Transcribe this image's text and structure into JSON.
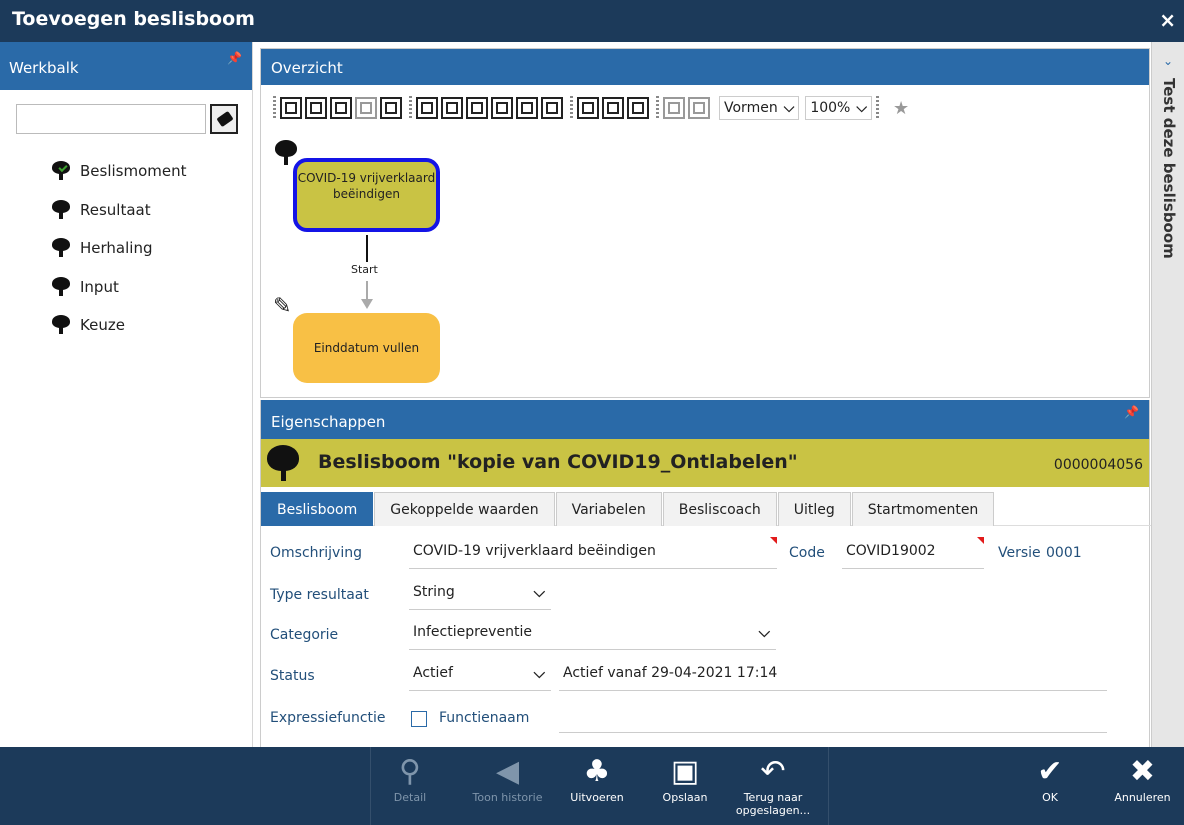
{
  "window": {
    "title": "Toevoegen beslisboom",
    "close_label": "×"
  },
  "werkbalk": {
    "title": "Werkbalk",
    "search_value": "",
    "items": [
      {
        "label": "Beslismoment"
      },
      {
        "label": "Resultaat"
      },
      {
        "label": "Herhaling"
      },
      {
        "label": "Input"
      },
      {
        "label": "Keuze"
      }
    ]
  },
  "overzicht": {
    "title": "Overzicht",
    "shape_select": "Vormen",
    "zoom_select": "100%",
    "nodes": {
      "node1_label": "COVID-19 vrijverklaard beëindigen",
      "connector_label": "Start",
      "node2_label": "Einddatum vullen"
    }
  },
  "eigenschappen": {
    "title": "Eigenschappen",
    "banner_title": "Beslisboom \"kopie van COVID19_Ontlabelen\"",
    "banner_number": "0000004056",
    "tabs": [
      {
        "label": "Beslisboom",
        "active": true
      },
      {
        "label": "Gekoppelde waarden"
      },
      {
        "label": "Variabelen"
      },
      {
        "label": "Besliscoach"
      },
      {
        "label": "Uitleg"
      },
      {
        "label": "Startmomenten"
      }
    ],
    "form": {
      "omschrijving_label": "Omschrijving",
      "omschrijving_value": "COVID-19 vrijverklaard beëindigen",
      "code_label": "Code",
      "code_value": "COVID19002",
      "versie_label": "Versie",
      "versie_value": "0001",
      "type_label": "Type resultaat",
      "type_value": "String",
      "categorie_label": "Categorie",
      "categorie_value": "Infectiepreventie",
      "status_label": "Status",
      "status_value": "Actief",
      "status_info": "Actief vanaf 29-04-2021 17:14",
      "expressie_label": "Expressiefunctie",
      "functienaam_label": "Functienaam"
    }
  },
  "rightbar": {
    "label": "Test deze beslisboom"
  },
  "bottombar": {
    "detail": "Detail",
    "historie": "Toon historie",
    "uitvoeren": "Uitvoeren",
    "opslaan": "Opslaan",
    "terug": "Terug naar opgeslagen...",
    "ok": "OK",
    "annuleren": "Annuleren"
  },
  "colors": {
    "titlebar": "#1c3a5a",
    "panel_header": "#2a6aa8",
    "banner": "#c9c344",
    "node_selected_border": "#1414e6",
    "node2_fill": "#f8c045",
    "required_marker": "#e21b1b"
  }
}
